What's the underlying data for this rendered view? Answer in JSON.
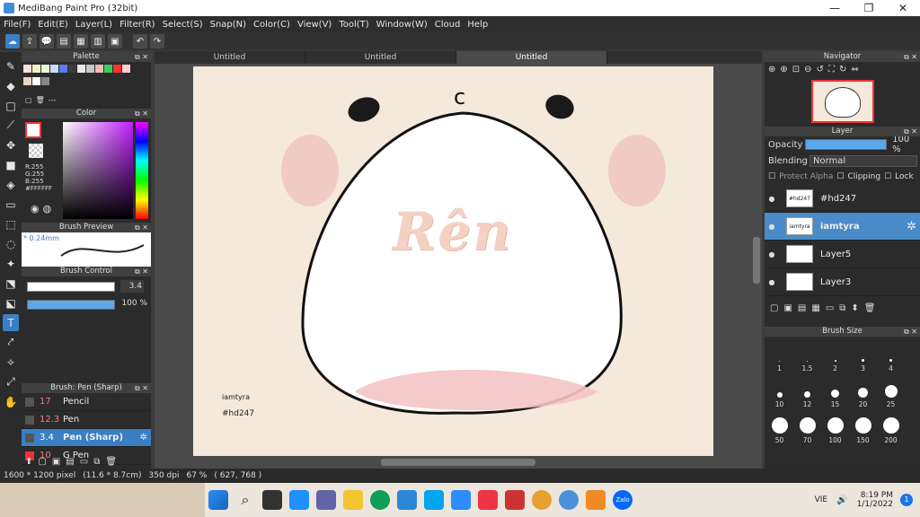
{
  "window": {
    "title": "MediBang Paint Pro (32bit)",
    "minimize": "—",
    "maximize": "❐",
    "close": "✕"
  },
  "menu": [
    "File(F)",
    "Edit(E)",
    "Layer(L)",
    "Filter(R)",
    "Select(S)",
    "Snap(N)",
    "Color(C)",
    "View(V)",
    "Tool(T)",
    "Window(W)",
    "Cloud",
    "Help"
  ],
  "toolbar_icons": [
    "cloud-icon",
    "share-icon",
    "comment-icon",
    "page-icon",
    "doc-icon",
    "grid-icon",
    "list-icon",
    "undo-icon",
    "redo-icon"
  ],
  "tabs": [
    "Untitled",
    "Untitled",
    "Untitled"
  ],
  "palette": {
    "title": "Palette",
    "dashes": "---",
    "colors": [
      "#f4e0e0",
      "#f6f0c8",
      "#e8f6d8",
      "#c8dcf8",
      "#5a7cf0",
      "#3c3c3c",
      "#e8e8e8",
      "#c8c8c8",
      "#f0b8b8",
      "#3ccc5c",
      "#ff3030",
      "#ffd0d0"
    ]
  },
  "color": {
    "title": "Color",
    "r": "R:255",
    "g": "G:255",
    "b": "B:255",
    "hex": "#FFFFFF"
  },
  "brush_preview": {
    "title": "Brush Preview",
    "size": "* 0.24mm"
  },
  "brush_control": {
    "title": "Brush Control",
    "size": "3.4",
    "opacity": "100 %",
    "opacity_value": 100
  },
  "brush_list": {
    "title": "Brush: Pen (Sharp)",
    "items": [
      {
        "size": "17",
        "name": "Pencil"
      },
      {
        "size": "12.3",
        "name": "Pen"
      },
      {
        "size": "3.4",
        "name": "Pen (Sharp)"
      },
      {
        "size": "10",
        "name": "G Pen"
      }
    ]
  },
  "canvas": {
    "text1": "iamtyra",
    "text2": "#hd247",
    "mouth": "c",
    "title_text": "Rên"
  },
  "navigator": {
    "title": "Navigator"
  },
  "layer": {
    "title": "Layer",
    "opacity_label": "Opacity",
    "opacity": "100 %",
    "opacity_value": 100,
    "blending_label": "Blending",
    "blending": "Normal",
    "protect_alpha": "Protect Alpha",
    "clipping": "Clipping",
    "lock": "Lock",
    "layers": [
      {
        "name": "#hd247",
        "thumb": "#hd247"
      },
      {
        "name": "iamtyra",
        "thumb": "iamtyra"
      },
      {
        "name": "Layer5",
        "thumb": ""
      },
      {
        "name": "Layer3",
        "thumb": ""
      }
    ]
  },
  "brush_size": {
    "title": "Brush Size",
    "sizes": [
      "1",
      "1.5",
      "2",
      "3",
      "4",
      "10",
      "12",
      "15",
      "20",
      "25",
      "50",
      "70",
      "100",
      "150",
      "200"
    ]
  },
  "status": {
    "dims": "1600 * 1200 pixel",
    "cm": "(11.6 * 8.7cm)",
    "dpi": "350 dpi",
    "zoom": "67 %",
    "coords": "( 627, 768 )"
  },
  "taskbar": {
    "lang": "VIE",
    "time": "8:19 PM",
    "date": "1/1/2022",
    "notif": "1",
    "zalo": "Zalo"
  }
}
